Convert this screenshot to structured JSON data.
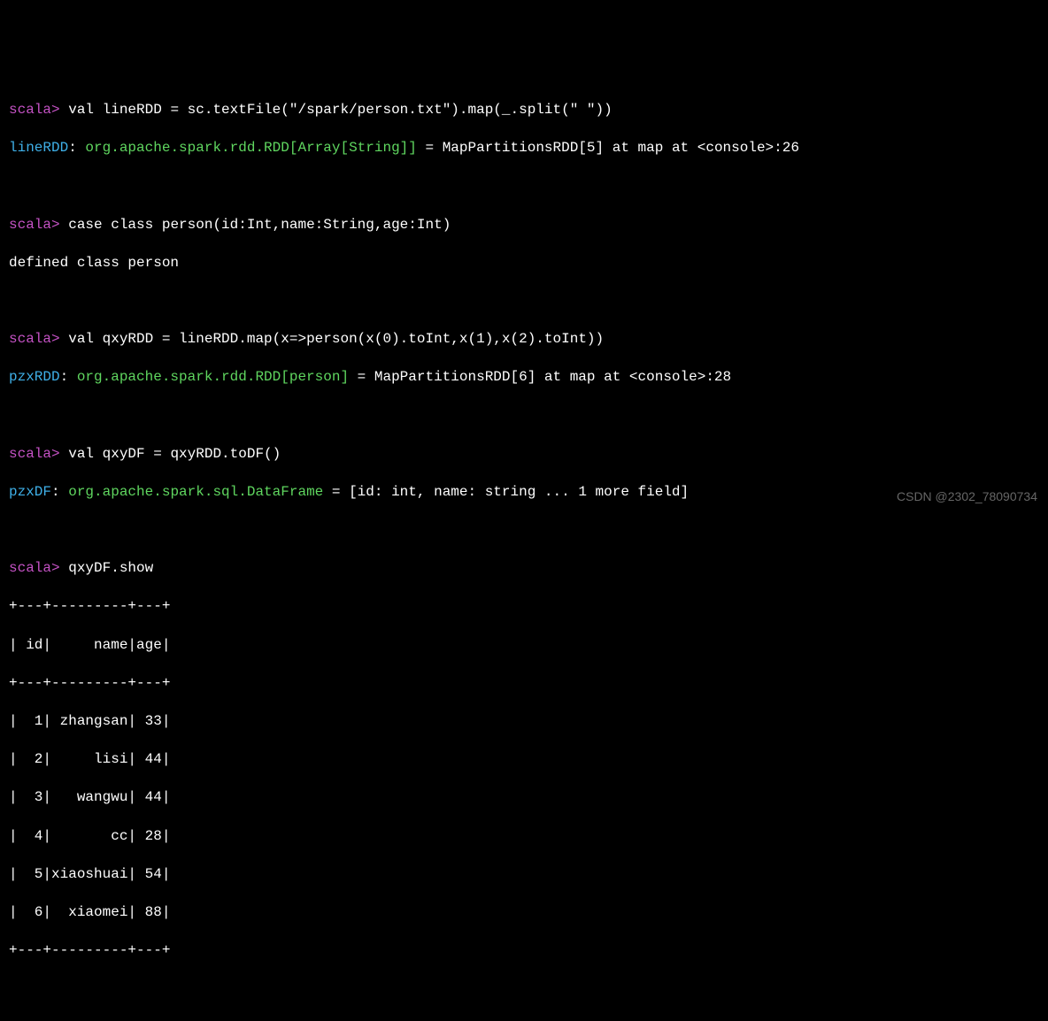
{
  "prompt": "scala>",
  "lines": {
    "cmd1": "val lineRDD = sc.textFile(\"/spark/person.txt\").map(_.split(\" \"))",
    "out1_var": "lineRDD",
    "out1_sep": ": ",
    "out1_type": "org.apache.spark.rdd.RDD[Array[String]]",
    "out1_rest": " = MapPartitionsRDD[5] at map at <console>:26",
    "cmd2": "case class person(id:Int,name:String,age:Int)",
    "out2": "defined class person",
    "cmd3": "val qxyRDD = lineRDD.map(x=>person(x(0).toInt,x(1),x(2).toInt))",
    "out3_var": "pzxRDD",
    "out3_sep": ": ",
    "out3_type": "org.apache.spark.rdd.RDD[person]",
    "out3_rest": " = MapPartitionsRDD[6] at map at <console>:28",
    "cmd4": "val qxyDF = qxyRDD.toDF()",
    "out4_var": "pzxDF",
    "out4_sep": ": ",
    "out4_type": "org.apache.spark.sql.DataFrame",
    "out4_rest": " = [id: int, name: string ... 1 more field]",
    "cmd5": "qxyDF.show"
  },
  "chart_data": {
    "type": "table",
    "columns": [
      "id",
      "name",
      "age"
    ],
    "rows": [
      {
        "id": 1,
        "name": "zhangsan",
        "age": 33
      },
      {
        "id": 2,
        "name": "lisi",
        "age": 44
      },
      {
        "id": 3,
        "name": "wangwu",
        "age": 44
      },
      {
        "id": 4,
        "name": "cc",
        "age": 28
      },
      {
        "id": 5,
        "name": "xiaoshuai",
        "age": 54
      },
      {
        "id": 6,
        "name": "xiaomei",
        "age": 88
      }
    ]
  },
  "table_render": {
    "border": "+---+---------+---+",
    "header": "| id|     name|age|",
    "rows": [
      "|  1| zhangsan| 33|",
      "|  2|     lisi| 44|",
      "|  3|   wangwu| 44|",
      "|  4|       cc| 28|",
      "|  5|xiaoshuai| 54|",
      "|  6|  xiaomei| 88|"
    ]
  },
  "watermark": "CSDN @2302_78090734"
}
